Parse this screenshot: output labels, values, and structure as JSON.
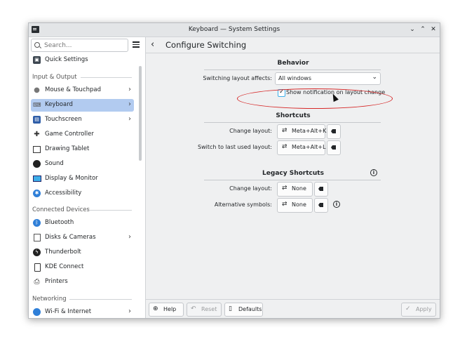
{
  "window": {
    "title": "Keyboard — System Settings",
    "minimize": "⌄",
    "maximize": "⌃",
    "close": "✕"
  },
  "sidebar": {
    "search_placeholder": "Search...",
    "quick_settings": "Quick Settings",
    "sections": {
      "input_output": "Input & Output",
      "connected_devices": "Connected Devices",
      "networking": "Networking"
    },
    "items": [
      {
        "label": "Mouse & Touchpad"
      },
      {
        "label": "Keyboard"
      },
      {
        "label": "Touchscreen"
      },
      {
        "label": "Game Controller"
      },
      {
        "label": "Drawing Tablet"
      },
      {
        "label": "Sound"
      },
      {
        "label": "Display & Monitor"
      },
      {
        "label": "Accessibility"
      },
      {
        "label": "Bluetooth"
      },
      {
        "label": "Disks & Cameras"
      },
      {
        "label": "Thunderbolt"
      },
      {
        "label": "KDE Connect"
      },
      {
        "label": "Printers"
      },
      {
        "label": "Wi-Fi & Internet"
      }
    ]
  },
  "header": {
    "title": "Configure Switching",
    "back": "‹"
  },
  "behavior": {
    "title": "Behavior",
    "switching_label": "Switching layout affects:",
    "switching_value": "All windows",
    "show_notification": "Show notification on layout change",
    "show_notification_checked": true
  },
  "shortcuts": {
    "title": "Shortcuts",
    "change_layout_label": "Change layout:",
    "change_layout_value": "Meta+Alt+K",
    "switch_last_label": "Switch to last used layout:",
    "switch_last_value": "Meta+Alt+L"
  },
  "legacy": {
    "title": "Legacy Shortcuts",
    "change_layout_label": "Change layout:",
    "change_layout_value": "None",
    "alt_symbols_label": "Alternative symbols:",
    "alt_symbols_value": "None"
  },
  "footer": {
    "help": "Help",
    "reset": "Reset",
    "defaults": "Defaults",
    "apply": "Apply"
  },
  "colors": {
    "accent": "#3daee9",
    "selection": "#b2cbf0",
    "annotation": "#d62828"
  }
}
